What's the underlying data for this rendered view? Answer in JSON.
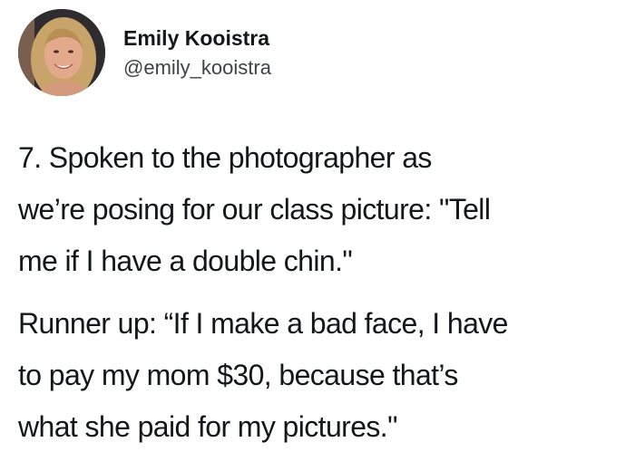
{
  "user": {
    "name": "Emily Kooistra",
    "handle": "@emily_kooistra"
  },
  "tweet": {
    "paragraph1": [
      "7. Spoken to the photographer as",
      "we’re posing for our class picture: \"Tell",
      "me if I have a double chin.\""
    ],
    "paragraph2": [
      "Runner up: “If I make a bad face, I have",
      "to pay my mom $30, because that’s",
      "what she paid for my pictures.\""
    ]
  },
  "colors": {
    "text": "#14171a",
    "handle": "#3f4347",
    "background": "#ffffff"
  }
}
